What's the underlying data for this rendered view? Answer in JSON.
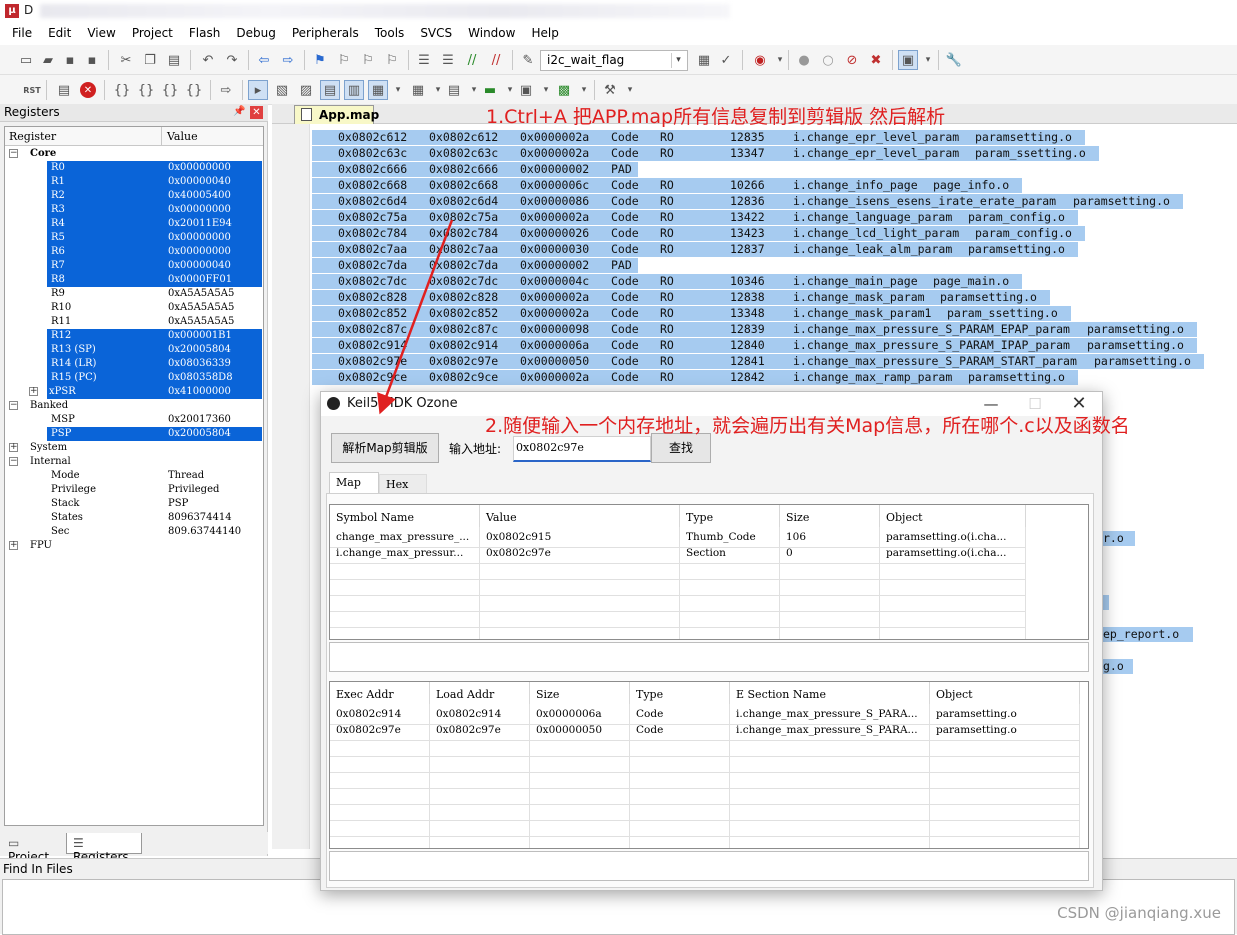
{
  "window": {
    "title": "D",
    "app_icon": "keil-uv-icon"
  },
  "menu": [
    "File",
    "Edit",
    "View",
    "Project",
    "Flash",
    "Debug",
    "Peripherals",
    "Tools",
    "SVCS",
    "Window",
    "Help"
  ],
  "toolbar": {
    "find_combo_value": "i2c_wait_flag",
    "rst_label": "RST"
  },
  "registers_panel": {
    "title": "Registers",
    "col_register": "Register",
    "col_value": "Value",
    "rows": [
      {
        "name": "Core",
        "value": "",
        "level": 0,
        "expander": "-",
        "selected": false,
        "bold": true
      },
      {
        "name": "R0",
        "value": "0x00000000",
        "level": 2,
        "selected": true
      },
      {
        "name": "R1",
        "value": "0x00000040",
        "level": 2,
        "selected": true
      },
      {
        "name": "R2",
        "value": "0x40005400",
        "level": 2,
        "selected": true
      },
      {
        "name": "R3",
        "value": "0x00000000",
        "level": 2,
        "selected": true
      },
      {
        "name": "R4",
        "value": "0x20011E94",
        "level": 2,
        "selected": true
      },
      {
        "name": "R5",
        "value": "0x00000000",
        "level": 2,
        "selected": true
      },
      {
        "name": "R6",
        "value": "0x00000000",
        "level": 2,
        "selected": true
      },
      {
        "name": "R7",
        "value": "0x00000040",
        "level": 2,
        "selected": true
      },
      {
        "name": "R8",
        "value": "0x0000FF01",
        "level": 2,
        "selected": true
      },
      {
        "name": "R9",
        "value": "0xA5A5A5A5",
        "level": 2,
        "selected": false
      },
      {
        "name": "R10",
        "value": "0xA5A5A5A5",
        "level": 2,
        "selected": false
      },
      {
        "name": "R11",
        "value": "0xA5A5A5A5",
        "level": 2,
        "selected": false
      },
      {
        "name": "R12",
        "value": "0x000001B1",
        "level": 2,
        "selected": true
      },
      {
        "name": "R13 (SP)",
        "value": "0x20005804",
        "level": 2,
        "selected": true
      },
      {
        "name": "R14 (LR)",
        "value": "0x08036339",
        "level": 2,
        "selected": true
      },
      {
        "name": "R15 (PC)",
        "value": "0x080358D8",
        "level": 2,
        "selected": true
      },
      {
        "name": "xPSR",
        "value": "0x41000000",
        "level": 1,
        "expander": "+",
        "selected": true
      },
      {
        "name": "Banked",
        "value": "",
        "level": 0,
        "expander": "-",
        "selected": false
      },
      {
        "name": "MSP",
        "value": "0x20017360",
        "level": 2,
        "selected": false
      },
      {
        "name": "PSP",
        "value": "0x20005804",
        "level": 2,
        "selected": true
      },
      {
        "name": "System",
        "value": "",
        "level": 0,
        "expander": "+",
        "selected": false
      },
      {
        "name": "Internal",
        "value": "",
        "level": 0,
        "expander": "-",
        "selected": false
      },
      {
        "name": "Mode",
        "value": "Thread",
        "level": 2,
        "selected": false
      },
      {
        "name": "Privilege",
        "value": "Privileged",
        "level": 2,
        "selected": false
      },
      {
        "name": "Stack",
        "value": "PSP",
        "level": 2,
        "selected": false
      },
      {
        "name": "States",
        "value": "8096374414",
        "level": 2,
        "selected": false
      },
      {
        "name": "Sec",
        "value": "809.63744140",
        "level": 2,
        "selected": false
      },
      {
        "name": "FPU",
        "value": "",
        "level": 0,
        "expander": "+",
        "selected": false
      }
    ],
    "tabs": [
      "Project",
      "Registers"
    ]
  },
  "editor": {
    "tab_label": "App.map",
    "annotation": "1.Ctrl+A 把APP.map所有信息复制到剪辑版 然后解析",
    "lines": [
      {
        "exec": "0x0802c612",
        "load": "0x0802c612",
        "size": "0x0000002a",
        "type": "Code",
        "attr": "RO",
        "idx": "12835",
        "section": "i.change_epr_level_param",
        "object": "paramsetting.o"
      },
      {
        "exec": "0x0802c63c",
        "load": "0x0802c63c",
        "size": "0x0000002a",
        "type": "Code",
        "attr": "RO",
        "idx": "13347",
        "section": "i.change_epr_level_param",
        "object": "param_ssetting.o"
      },
      {
        "exec": "0x0802c666",
        "load": "0x0802c666",
        "size": "0x00000002",
        "type": "PAD",
        "attr": "",
        "idx": "",
        "section": "",
        "object": ""
      },
      {
        "exec": "0x0802c668",
        "load": "0x0802c668",
        "size": "0x0000006c",
        "type": "Code",
        "attr": "RO",
        "idx": "10266",
        "section": "i.change_info_page",
        "object": "page_info.o"
      },
      {
        "exec": "0x0802c6d4",
        "load": "0x0802c6d4",
        "size": "0x00000086",
        "type": "Code",
        "attr": "RO",
        "idx": "12836",
        "section": "i.change_isens_esens_irate_erate_param",
        "object": "paramsetting.o"
      },
      {
        "exec": "0x0802c75a",
        "load": "0x0802c75a",
        "size": "0x0000002a",
        "type": "Code",
        "attr": "RO",
        "idx": "13422",
        "section": "i.change_language_param",
        "object": "param_config.o"
      },
      {
        "exec": "0x0802c784",
        "load": "0x0802c784",
        "size": "0x00000026",
        "type": "Code",
        "attr": "RO",
        "idx": "13423",
        "section": "i.change_lcd_light_param",
        "object": "param_config.o"
      },
      {
        "exec": "0x0802c7aa",
        "load": "0x0802c7aa",
        "size": "0x00000030",
        "type": "Code",
        "attr": "RO",
        "idx": "12837",
        "section": "i.change_leak_alm_param",
        "object": "paramsetting.o"
      },
      {
        "exec": "0x0802c7da",
        "load": "0x0802c7da",
        "size": "0x00000002",
        "type": "PAD",
        "attr": "",
        "idx": "",
        "section": "",
        "object": ""
      },
      {
        "exec": "0x0802c7dc",
        "load": "0x0802c7dc",
        "size": "0x0000004c",
        "type": "Code",
        "attr": "RO",
        "idx": "10346",
        "section": "i.change_main_page",
        "object": "page_main.o"
      },
      {
        "exec": "0x0802c828",
        "load": "0x0802c828",
        "size": "0x0000002a",
        "type": "Code",
        "attr": "RO",
        "idx": "12838",
        "section": "i.change_mask_param",
        "object": "paramsetting.o"
      },
      {
        "exec": "0x0802c852",
        "load": "0x0802c852",
        "size": "0x0000002a",
        "type": "Code",
        "attr": "RO",
        "idx": "13348",
        "section": "i.change_mask_param1",
        "object": "param_ssetting.o"
      },
      {
        "exec": "0x0802c87c",
        "load": "0x0802c87c",
        "size": "0x00000098",
        "type": "Code",
        "attr": "RO",
        "idx": "12839",
        "section": "i.change_max_pressure_S_PARAM_EPAP_param",
        "object": "paramsetting.o"
      },
      {
        "exec": "0x0802c914",
        "load": "0x0802c914",
        "size": "0x0000006a",
        "type": "Code",
        "attr": "RO",
        "idx": "12840",
        "section": "i.change_max_pressure_S_PARAM_IPAP_param",
        "object": "paramsetting.o"
      },
      {
        "exec": "0x0802c97e",
        "load": "0x0802c97e",
        "size": "0x00000050",
        "type": "Code",
        "attr": "RO",
        "idx": "12841",
        "section": "i.change_max_pressure_S_PARAM_START_param",
        "object": "paramsetting.o"
      },
      {
        "exec": "0x0802c9ce",
        "load": "0x0802c9ce",
        "size": "0x0000002a",
        "type": "Code",
        "attr": "RO",
        "idx": "12842",
        "section": "i.change_max_ramp_param",
        "object": "paramsetting.o"
      }
    ],
    "partial_right_fragments": [
      "r.o",
      "ep_report.o",
      "g.o"
    ]
  },
  "dialog": {
    "title": "Keil5 MDK Ozone",
    "parse_button": "解析Map剪辑版",
    "address_label": "输入地址:",
    "address_value": "0x0802c97e",
    "search_button": "查找",
    "tabs": [
      "Map",
      "Hex"
    ],
    "annotation": "2.随便输入一个内存地址，就会遍历出有关Map信息，所在哪个.c以及函数名",
    "symbol_table": {
      "columns": [
        "Symbol Name",
        "Value",
        "Type",
        "Size",
        "Object"
      ],
      "rows": [
        [
          "change_max_pressure_...",
          "0x0802c915",
          "Thumb_Code",
          "106",
          "paramsetting.o(i.cha..."
        ],
        [
          "i.change_max_pressur...",
          "0x0802c97e",
          "Section",
          "0",
          "paramsetting.o(i.cha..."
        ]
      ]
    },
    "section_table": {
      "columns": [
        "Exec Addr",
        "Load Addr",
        "Size",
        "Type",
        "E Section Name",
        "Object"
      ],
      "rows": [
        [
          "0x0802c914",
          "0x0802c914",
          "0x0000006a",
          "Code",
          "i.change_max_pressure_S_PARA...",
          "paramsetting.o"
        ],
        [
          "0x0802c97e",
          "0x0802c97e",
          "0x00000050",
          "Code",
          "i.change_max_pressure_S_PARA...",
          "paramsetting.o"
        ]
      ]
    }
  },
  "find_panel": {
    "title": "Find In Files"
  },
  "watermark": "CSDN @jianqiang.xue",
  "colors": {
    "selection": "#0a64d8",
    "code_highlight": "#a6cbf0",
    "annotation": "#e02020",
    "doc_tab": "#f8f8c8"
  }
}
